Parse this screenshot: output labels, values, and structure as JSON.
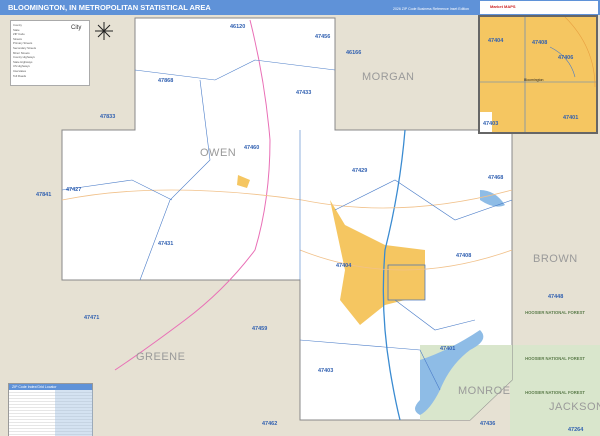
{
  "header": {
    "title": "BLOOMINGTON, IN METROPOLITAN STATISTICAL AREA",
    "edition": "2026 ZIP Code Business Reference Inset Edition",
    "logo": "Market MAPS"
  },
  "legend": {
    "items": [
      "County",
      "State",
      "ZIP Code",
      "Streets",
      "Primary Streets",
      "Secondary Streets",
      "Minor Streets",
      "County Highways",
      "State Highways",
      "US Highways",
      "Interstates",
      "Toll Roads"
    ],
    "city_label": "City"
  },
  "index": {
    "title": "ZIP Code Index/Grid Locator"
  },
  "counties": [
    "OWEN",
    "MORGAN",
    "BROWN",
    "GREENE",
    "MONROE",
    "JACKSON"
  ],
  "zips": [
    "46120",
    "47456",
    "46166",
    "47868",
    "47433",
    "47833",
    "47460",
    "47429",
    "47468",
    "47841",
    "47427",
    "47431",
    "47404",
    "47408",
    "47448",
    "47471",
    "47459",
    "47401",
    "47403",
    "47462",
    "47436",
    "47264"
  ],
  "forests": [
    "HOOSIER NATIONAL FOREST",
    "HOOSIER NATIONAL FOREST",
    "HOOSIER NATIONAL FOREST"
  ],
  "inset": {
    "zips": [
      "47404",
      "47408",
      "47406",
      "47403",
      "47401"
    ],
    "city": "Bloomington"
  },
  "colors": {
    "header": "#5f92d8",
    "outside": "#e6e1d3",
    "city": "#f5c661",
    "water": "#8ebce6",
    "forest": "#d9e6cc",
    "zipline": "#4a7cc8"
  }
}
